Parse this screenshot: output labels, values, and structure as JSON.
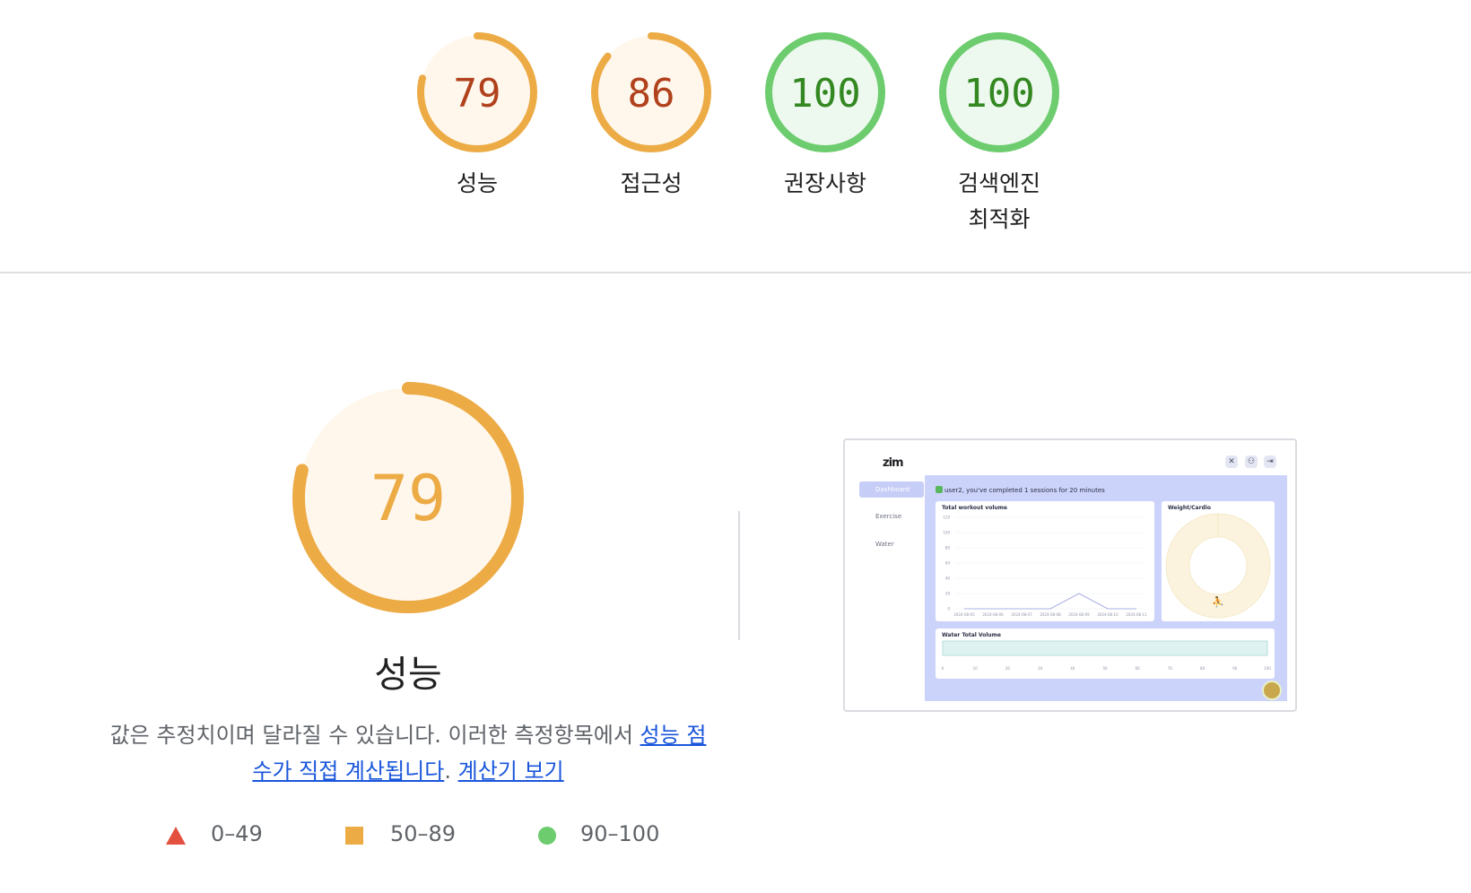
{
  "scores": [
    {
      "value": "79",
      "score": 79,
      "label": "성능",
      "status": "average",
      "color": "#ecab45",
      "fill": "#fff7ec",
      "text_color": "#b0411c"
    },
    {
      "value": "86",
      "score": 86,
      "label": "접근성",
      "status": "average",
      "color": "#ecab45",
      "fill": "#fff7ec",
      "text_color": "#b0411c"
    },
    {
      "value": "100",
      "score": 100,
      "label": "권장사항",
      "status": "pass",
      "color": "#6ccc6e",
      "fill": "#edf8ef",
      "text_color": "#338821"
    },
    {
      "value": "100",
      "score": 100,
      "label": "검색엔진\n최적화",
      "status": "pass",
      "color": "#6ccc6e",
      "fill": "#edf8ef",
      "text_color": "#338821"
    }
  ],
  "performance": {
    "score_text": "79",
    "score": 79,
    "title": "성능",
    "desc_text": "값은 추정치이며 달라질 수 있습니다. 이러한 측정항목에서 ",
    "link1": "성능 점수가 직접 계산됩니다",
    "period": ". ",
    "link2": "계산기 보기",
    "color": "#ecab45",
    "fill": "#fff7ec"
  },
  "legend": [
    {
      "icon": "triangle-icon",
      "range": "0–49",
      "color": "#e4503f"
    },
    {
      "icon": "square-icon",
      "range": "50–89",
      "color": "#ecab45"
    },
    {
      "icon": "circle-icon",
      "range": "90–100",
      "color": "#6ccc6e"
    }
  ],
  "screenshot": {
    "logo": "zim",
    "nav": [
      "Dashboard",
      "Exercise",
      "Water"
    ],
    "message": "user2, you've completed 1 sessions for 20 minutes",
    "chart1": {
      "title": "Total workout volume",
      "yticks": [
        "120",
        "100",
        "80",
        "60",
        "40",
        "20",
        "0"
      ],
      "xticks": [
        "2024-08-05",
        "2024-08-06",
        "2024-08-07",
        "2024-08-08",
        "2024-08-09",
        "2024-08-10",
        "2024-08-11"
      ]
    },
    "chart2": {
      "title": "Weight/Cardio"
    },
    "chart3": {
      "title": "Water Total Volume",
      "xticks": [
        "0",
        "10",
        "20",
        "30",
        "40",
        "50",
        "60",
        "70",
        "80",
        "90",
        "100"
      ]
    }
  }
}
